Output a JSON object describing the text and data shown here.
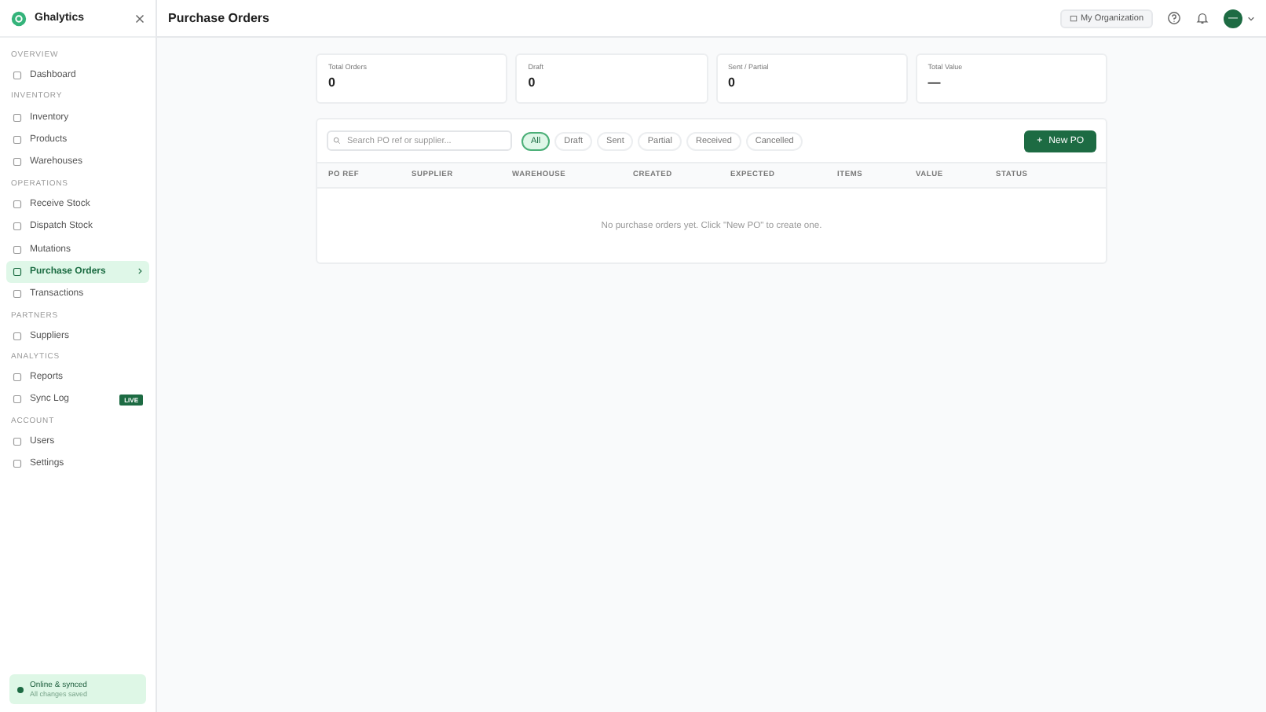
{
  "brand": {
    "name": "Ghalytics"
  },
  "sidebar": {
    "sections": [
      {
        "title": "OVERVIEW",
        "items": [
          {
            "label": "Dashboard",
            "selected": false
          }
        ]
      },
      {
        "title": "INVENTORY",
        "items": [
          {
            "label": "Inventory",
            "selected": false
          },
          {
            "label": "Products",
            "selected": false
          },
          {
            "label": "Warehouses",
            "selected": false
          }
        ]
      },
      {
        "title": "OPERATIONS",
        "items": [
          {
            "label": "Receive Stock",
            "selected": false
          },
          {
            "label": "Dispatch Stock",
            "selected": false
          },
          {
            "label": "Mutations",
            "selected": false
          },
          {
            "label": "Purchase Orders",
            "selected": true
          },
          {
            "label": "Transactions",
            "selected": false
          }
        ]
      },
      {
        "title": "PARTNERS",
        "items": [
          {
            "label": "Suppliers",
            "selected": false
          }
        ]
      },
      {
        "title": "ANALYTICS",
        "items": [
          {
            "label": "Reports",
            "selected": false
          },
          {
            "label": "Sync Log",
            "selected": false,
            "badge": "LIVE"
          }
        ]
      },
      {
        "title": "ACCOUNT",
        "items": [
          {
            "label": "Users",
            "selected": false
          },
          {
            "label": "Settings",
            "selected": false
          }
        ]
      }
    ],
    "status": {
      "title": "Online & synced",
      "subtitle": "All changes saved"
    }
  },
  "header": {
    "title": "Purchase Orders",
    "org": "My Organization",
    "avatar": "—"
  },
  "stats": [
    {
      "label": "Total Orders",
      "value": "0"
    },
    {
      "label": "Draft",
      "value": "0"
    },
    {
      "label": "Sent / Partial",
      "value": "0"
    },
    {
      "label": "Total Value",
      "value": "—"
    }
  ],
  "search": {
    "placeholder": "Search PO ref or supplier..."
  },
  "filters": [
    {
      "label": "All",
      "selected": true
    },
    {
      "label": "Draft",
      "selected": false
    },
    {
      "label": "Sent",
      "selected": false
    },
    {
      "label": "Partial",
      "selected": false
    },
    {
      "label": "Received",
      "selected": false
    },
    {
      "label": "Cancelled",
      "selected": false
    }
  ],
  "new_button": {
    "icon": "+",
    "label": "New PO"
  },
  "table": {
    "columns": [
      "PO REF",
      "SUPPLIER",
      "WAREHOUSE",
      "CREATED",
      "EXPECTED",
      "ITEMS",
      "VALUE",
      "STATUS"
    ],
    "empty": "No purchase orders yet. Click \"New PO\" to create one."
  }
}
